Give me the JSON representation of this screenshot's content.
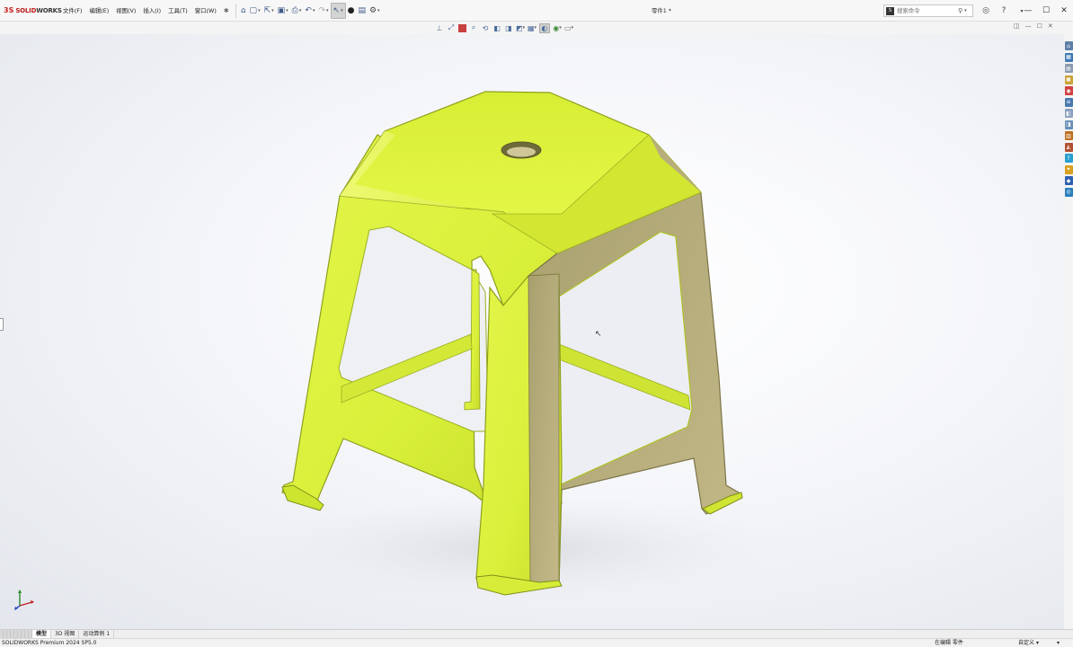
{
  "app": {
    "brand_mark": "3S",
    "brand_name_red": "SOLID",
    "brand_name_dark": "WORKS",
    "document_title": "零件1 *"
  },
  "menu": [
    {
      "id": "file",
      "label": "文件(F)"
    },
    {
      "id": "edit",
      "label": "编辑(E)"
    },
    {
      "id": "view",
      "label": "视图(V)"
    },
    {
      "id": "insert",
      "label": "插入(I)"
    },
    {
      "id": "tools",
      "label": "工具(T)"
    },
    {
      "id": "window",
      "label": "窗口(W)"
    }
  ],
  "quick_toolbar": {
    "icons": [
      "home-icon",
      "new-document-icon",
      "open-icon",
      "save-icon",
      "print-icon",
      "undo-icon",
      "redo-icon",
      "select-icon",
      "rebuild-icon",
      "file-properties-icon",
      "options-icon"
    ],
    "active": "select-icon"
  },
  "search": {
    "placeholder": "搜索命令",
    "cmd_glyph": "S"
  },
  "heads_up_toolbar": {
    "icons": [
      "view-orientation-icon",
      "zoom-to-fit-icon",
      "section-view-icon",
      "zoom-area-icon",
      "previous-view-icon",
      "dynamic-annotation-icon",
      "view-settings-icon",
      "display-style-icon",
      "hide-show-icon",
      "edit-appearance-icon",
      "apply-scene-icon",
      "display-settings-icon"
    ]
  },
  "viewport": {
    "model_color": "#d9f03a",
    "model_shade": "#b5ad78",
    "background": "#f4f5f8"
  },
  "bottom_tabs": [
    {
      "id": "model",
      "label": "模型",
      "active": true
    },
    {
      "id": "3d-views",
      "label": "3D 视图",
      "active": false
    },
    {
      "id": "motion-study",
      "label": "运动算例 1",
      "active": false
    }
  ],
  "status": {
    "product": "SOLIDWORKS Premium 2024 SP5.0",
    "editing": "在编辑 零件",
    "units": "自定义",
    "units_dropdown": "▾"
  },
  "task_pane_colors": [
    "#5b7fa8",
    "#3f7ab6",
    "#8a9bb0",
    "#c9a23a",
    "#d04040",
    "#4a7bb0",
    "#8aa0c0",
    "#6a8fb8",
    "#c07020",
    "#b05030",
    "#2aa0d0",
    "#d8a020",
    "#3060b0",
    "#2a7fc0"
  ]
}
